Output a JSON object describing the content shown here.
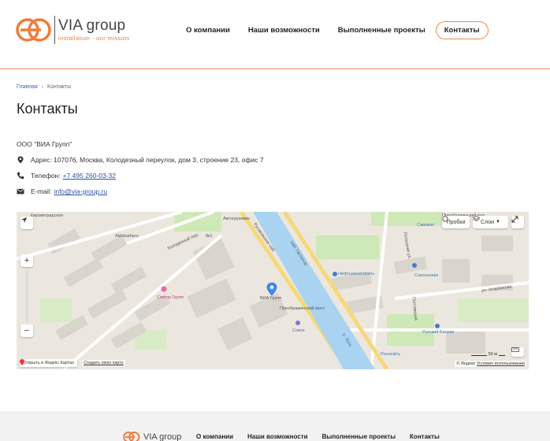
{
  "logo": {
    "name": "VIA group",
    "tagline": "installation - our mission"
  },
  "nav": {
    "about": "О компании",
    "capabilities": "Наши возможности",
    "projects": "Выполненные проекты",
    "contacts": "Контакты"
  },
  "breadcrumb": {
    "home": "Главная",
    "separator": "›",
    "current": "Контакты"
  },
  "page": {
    "title": "Контакты"
  },
  "contacts": {
    "company": "ООО \"ВИА Групп\"",
    "address": "Адрес: 107076, Москва, Колодезный переулок, дом 3, строение 23, офис 7",
    "phone_label": "Телефон:",
    "phone": "+7 495 260-03-32",
    "email_label": "E-mail:",
    "email": "info@via-group.ru"
  },
  "map": {
    "traffic": "Пробки",
    "layers": "Слои",
    "zoom_in": "+",
    "zoom_out": "−",
    "open_in": "Открыть в Яндекс.Картах",
    "create_own": "Создать свою карту",
    "copyright": "© Яндекс",
    "terms": "Условия использования",
    "scale": "50 м",
    "labels": {
      "rusakovskaya": "Русаковская наб.",
      "gastello": "наб. Гастелло",
      "yauza": "р. Яуза",
      "sector_gruppa": "Сектор Групп",
      "preobrazhensky": "Преображенский мост",
      "via_group": "ВИА Групп",
      "neftemagistral": "Нефтьмагистраль",
      "sandbox": "Сокол",
      "russian_banyan": "Русский Банник",
      "sokolniki": "Сокольники",
      "kolodezny": "Колодезный пер.",
      "atarbekova": "ул. Атарбекова",
      "preobr_val": "Преображенский вал",
      "kirovograd": "Кировоградская",
      "aldobarbers": "Aldobarbers",
      "avtogrand": "Автогрузовик",
      "polevaya": "Потешная ул.",
      "poltav": "Полтавский",
      "rosneft": "Роснефть",
      "samokat": "Самокат",
      "house_81": "8к1"
    }
  },
  "footer": {
    "logo_name": "VIA group",
    "about": "О компании",
    "capabilities": "Наши возможности",
    "projects": "Выполненные проекты",
    "contacts": "Контакты"
  }
}
